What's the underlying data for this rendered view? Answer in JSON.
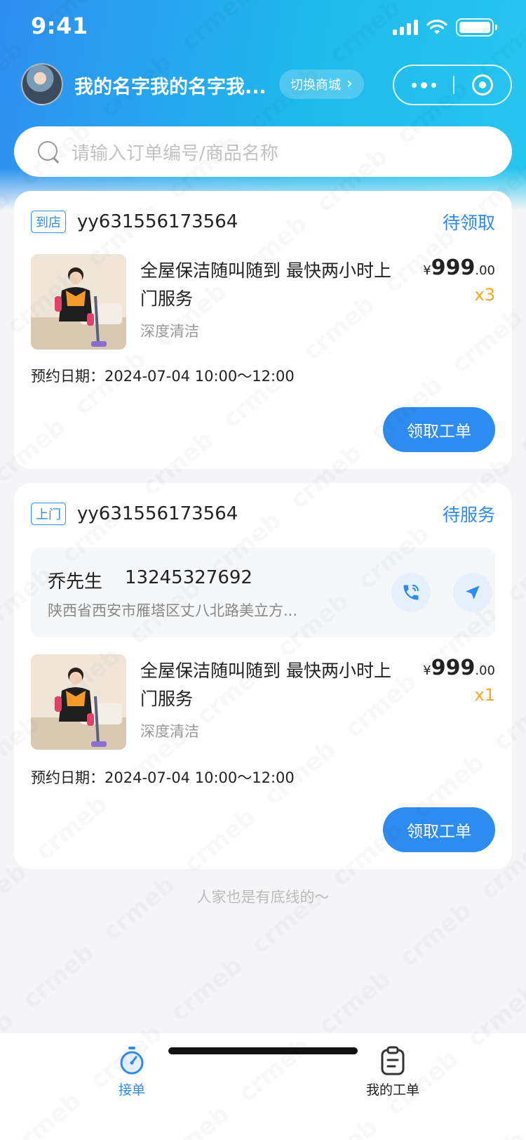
{
  "status_bar": {
    "time": "9:41"
  },
  "header": {
    "user_name": "我的名字我的名字我...",
    "switch_mall_label": "切换商城",
    "switch_mall_chevron": "›"
  },
  "search": {
    "placeholder": "请输入订单编号/商品名称"
  },
  "orders": [
    {
      "type_tag": "到店",
      "order_no": "yy631556173564",
      "status": "待领取",
      "product": {
        "title": "全屋保洁随叫随到 最快两小时上门服务",
        "sku": "深度清洁",
        "currency": "¥",
        "price_int": "999",
        "price_dec": ".00",
        "qty": "x3"
      },
      "appointment": "预约日期：2024-07-04 10:00～12:00",
      "action_label": "领取工单"
    },
    {
      "type_tag": "上门",
      "order_no": "yy631556173564",
      "status": "待服务",
      "customer": {
        "name": "乔先生",
        "phone": "13245327692",
        "address": "陕西省西安市雁塔区丈八北路美立方..."
      },
      "product": {
        "title": "全屋保洁随叫随到 最快两小时上门服务",
        "sku": "深度清洁",
        "currency": "¥",
        "price_int": "999",
        "price_dec": ".00",
        "qty": "x1"
      },
      "appointment": "预约日期：2024-07-04 10:00～12:00",
      "action_label": "领取工单"
    }
  ],
  "bottom_tip": "人家也是有底线的～",
  "tab_bar": {
    "tabs": [
      {
        "label": "接单",
        "icon": "stopwatch-icon",
        "active": true
      },
      {
        "label": "我的工单",
        "icon": "clipboard-icon",
        "active": false
      }
    ]
  },
  "watermark": "crmeb",
  "colors": {
    "primary": "#2e8cf0",
    "qty": "#f5a623",
    "header_gradient_start": "#2f8ef0",
    "header_gradient_end": "#27c6ef"
  }
}
